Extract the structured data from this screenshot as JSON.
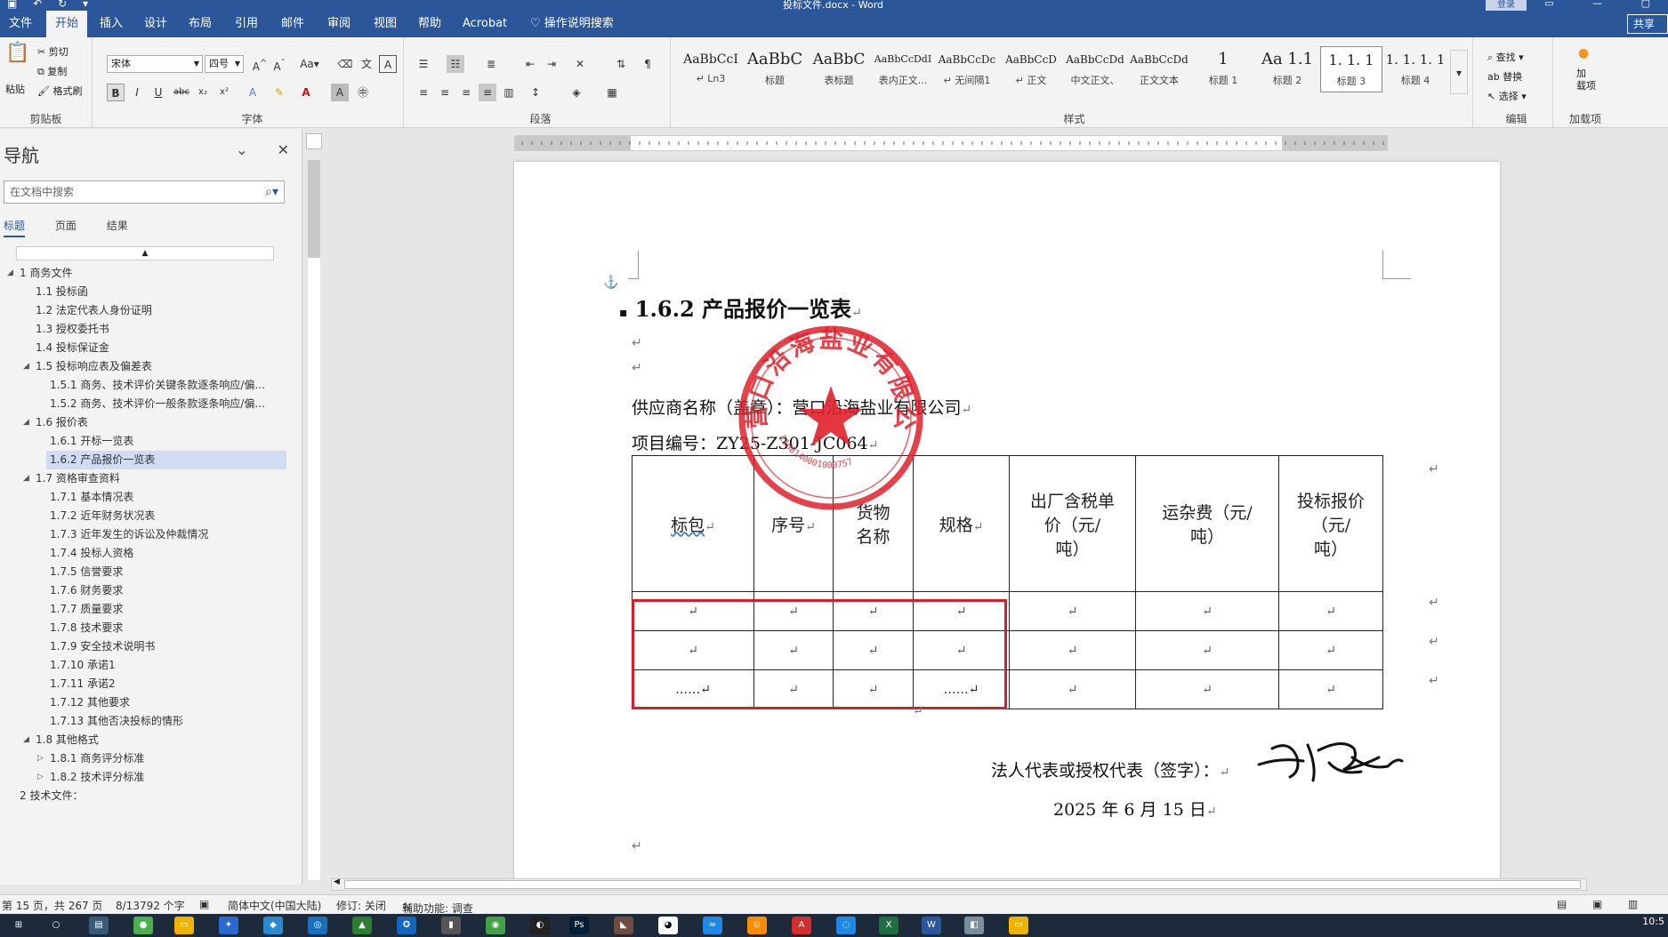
{
  "window": {
    "title": "投标文件.docx  -  Word",
    "login_label": "登录"
  },
  "ribbon_tabs": [
    "文件",
    "开始",
    "插入",
    "设计",
    "布局",
    "引用",
    "邮件",
    "审阅",
    "视图",
    "帮助",
    "Acrobat",
    "操作说明搜索"
  ],
  "share_label": "共享",
  "clipboard": {
    "paste": "粘贴",
    "cut": "剪切",
    "copy": "复制",
    "format_painter": "格式刷",
    "group": "剪贴板"
  },
  "font": {
    "name": "宋体",
    "size": "四号",
    "group": "字体"
  },
  "paragraph": {
    "group": "段落"
  },
  "styles": {
    "group": "样式",
    "items": [
      {
        "sample": "AaBbCcI",
        "name": "↵ Ln3"
      },
      {
        "sample": "AaBbC",
        "name": "标题"
      },
      {
        "sample": "AaBbC",
        "name": "表标题"
      },
      {
        "sample": "AaBbCcDdI",
        "name": "表内正文..."
      },
      {
        "sample": "AaBbCcDc",
        "name": "↵ 无间隔1"
      },
      {
        "sample": "AaBbCcD",
        "name": "↵ 正文"
      },
      {
        "sample": "AaBbCcDd",
        "name": "中文正文、"
      },
      {
        "sample": "AaBbCcDd",
        "name": "正文文本"
      },
      {
        "sample": "1",
        "name": "标题 1"
      },
      {
        "sample": "Aa 1.1",
        "name": "标题 2"
      },
      {
        "sample": "1. 1. 1",
        "name": "标题 3"
      },
      {
        "sample": "1. 1. 1. 1",
        "name": "标题 4"
      }
    ]
  },
  "editing": {
    "find": "查找",
    "replace": "替换",
    "select": "选择",
    "group": "编辑"
  },
  "addins": {
    "label": "加\n载项",
    "group": "加载项"
  },
  "nav": {
    "title": "导航",
    "search_placeholder": "在文档中搜索",
    "tabs": [
      "标题",
      "页面",
      "结果"
    ],
    "items": [
      {
        "label": "1 商务文件",
        "level": 0,
        "toggle": "◢"
      },
      {
        "label": "1.1 投标函",
        "level": 1
      },
      {
        "label": "1.2 法定代表人身份证明",
        "level": 1
      },
      {
        "label": "1.3 授权委托书",
        "level": 1
      },
      {
        "label": "1.4 投标保证金",
        "level": 1
      },
      {
        "label": "1.5 投标响应表及偏差表",
        "level": 1,
        "toggle": "◢"
      },
      {
        "label": "1.5.1 商务、技术评价关键条款逐条响应/偏...",
        "level": 2
      },
      {
        "label": "1.5.2 商务、技术评价一般条款逐条响应/偏...",
        "level": 2
      },
      {
        "label": "1.6 报价表",
        "level": 1,
        "toggle": "◢"
      },
      {
        "label": "1.6.1 开标一览表",
        "level": 2
      },
      {
        "label": "1.6.2 产品报价一览表",
        "level": 2,
        "selected": true
      },
      {
        "label": "1.7 资格审查资料",
        "level": 1,
        "toggle": "◢"
      },
      {
        "label": "1.7.1 基本情况表",
        "level": 2
      },
      {
        "label": "1.7.2 近年财务状况表",
        "level": 2
      },
      {
        "label": "1.7.3 近年发生的诉讼及仲裁情况",
        "level": 2
      },
      {
        "label": "1.7.4 投标人资格",
        "level": 2
      },
      {
        "label": "1.7.5 信誉要求",
        "level": 2
      },
      {
        "label": "1.7.6 财务要求",
        "level": 2
      },
      {
        "label": "1.7.7 质量要求",
        "level": 2
      },
      {
        "label": "1.7.8 技术要求",
        "level": 2
      },
      {
        "label": "1.7.9 安全技术说明书",
        "level": 2
      },
      {
        "label": "1.7.10 承诺1",
        "level": 2
      },
      {
        "label": "1.7.11 承诺2",
        "level": 2
      },
      {
        "label": "1.7.12 其他要求",
        "level": 2
      },
      {
        "label": "1.7.13 其他否决投标的情形",
        "level": 2
      },
      {
        "label": "1.8 其他格式",
        "level": 1,
        "toggle": "◢"
      },
      {
        "label": "1.8.1 商务评分标准",
        "level": 2,
        "toggle": "▷"
      },
      {
        "label": "1.8.2 技术评分标准",
        "level": 2,
        "toggle": "▷"
      },
      {
        "label": "2 技术文件：",
        "level": 0
      }
    ]
  },
  "document": {
    "heading": "1.6.2 产品报价一览表",
    "supplier_line": "供应商名称（盖章）：营口沿海盐业有限公司",
    "project_line": "项目编号：ZY25-Z301-JC064",
    "table_headers": [
      "标包",
      "序号",
      "货物\n名称",
      "规格",
      "出厂含税单\n价（元/\n吨）",
      "运杂费（元/\n吨）",
      "投标报价\n（元/\n吨）"
    ],
    "table_rows": [
      [
        "↵",
        "↵",
        "↵",
        "↵",
        "↵",
        "↵",
        "↵"
      ],
      [
        "↵",
        "↵",
        "↵",
        "↵",
        "↵",
        "↵",
        "↵"
      ],
      [
        "……↵",
        "↵",
        "↵",
        "……↵",
        "↵",
        "↵",
        "↵"
      ]
    ],
    "signature_line": "法人代表或授权代表（签字）：",
    "date_line": "2025 年 6 月 15 日",
    "stamp_text": "营口沿海盐业有限公司",
    "stamp_number": "2108140001000757",
    "paragraph_mark": "↵"
  },
  "status": {
    "page": "第 15 页，共 267 页",
    "words": "8/13792 个字",
    "language": "简体中文(中国大陆)",
    "track": "修订: 关闭",
    "accessibility": "辅助功能: 调查"
  },
  "taskbar": {
    "clock": "10:5"
  },
  "colors": {
    "brand": "#2b579a",
    "highlight_box": "#d81e2a",
    "stamp": "#e0202a"
  }
}
